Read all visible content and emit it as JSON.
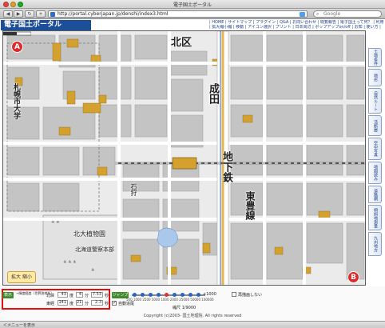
{
  "window": {
    "title": "電子国土ポータル"
  },
  "browser": {
    "url": "http://portal.cyberjapan.jp/denshi/index3.html",
    "search_placeholder": "Google"
  },
  "site": {
    "logo": "電子国土ポータル",
    "menu_row1": "| HOME | サイトマップ | プラグイン | Q&A | お問い合わせ | 閲覧報告 | 電子国土って何？ | 利用規約 |",
    "menu_row2": "| 拡大縮小縮 | 移動 | アイコン選択 | プリント | 日本周辺 | ポップアップon/off | お知 | 使い方 |"
  },
  "map": {
    "marker_a": "A",
    "marker_b": "B",
    "labels": {
      "ku": "北区",
      "university": "札幌市大学",
      "naru": "成田",
      "chika": "地下鉄",
      "toho": "東豊線",
      "garden": "北大植物園",
      "hq": "北海道警察本部",
      "ishikari": "石狩"
    },
    "nav_label": "拡大 縮小",
    "colors": {
      "building_orange": "#d4a02e",
      "block_gray": "#c7c7c7",
      "road_white": "#ffffff",
      "rail_blue": "#4a7bd4",
      "marker_red": "#dd2a2a"
    }
  },
  "side_tabs": [
    "土地条件",
    "地形",
    "自然ルート",
    "活断層",
    "空中写真",
    "地図読み",
    "道路網",
    "傾斜地測量",
    "九州地方"
  ],
  "controls": {
    "display_label": "表示",
    "hint": "→緯度経度（世界測地系）",
    "lat_label": "北緯",
    "lat_deg": "43",
    "lat_min": "4",
    "lat_sec": "7.53",
    "lon_label": "東経",
    "lon_deg": "141",
    "lon_min": "21",
    "lon_sec": "2.3",
    "deg_unit": "度",
    "min_unit": "分",
    "sec_unit": "秒",
    "jump_label": "ジャンプ",
    "auto_label": "自動追尾",
    "zoom_scale_labels": [
      "500",
      "1000",
      "2500",
      "5000",
      "1000",
      "2000",
      "25000",
      "50000",
      "100000"
    ],
    "zoom_extent": "+1000",
    "overlay_label": "再描画しない",
    "scale_text": "縮尺 1/9000",
    "copyright": "Copyright (c)2003- 国土地理院. All rights reserved"
  },
  "status": {
    "text": "＜メニューを表示"
  }
}
